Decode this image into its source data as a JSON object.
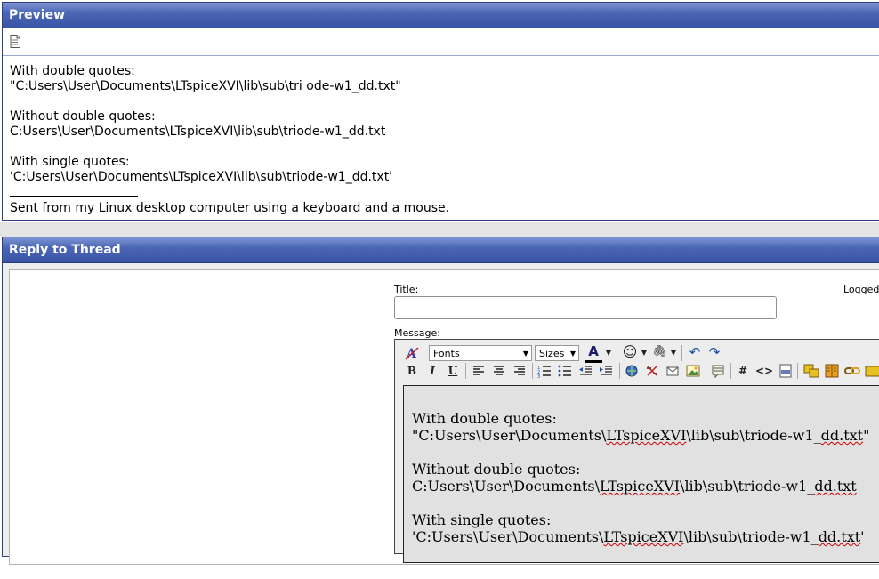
{
  "preview": {
    "header": "Preview",
    "icon": "document-icon",
    "lines": [
      "With double quotes:",
      "\"C:Users\\User\\Documents\\LTspiceXVI\\lib\\sub\\tri ode-w1_dd.txt\"",
      "",
      "Without double quotes:",
      "C:Users\\User\\Documents\\LTspiceXVI\\lib\\sub\\triode-w1_dd.txt",
      "",
      "With single quotes:",
      "'C:Users\\User\\Documents\\LTspiceXVI\\lib\\sub\\triode-w1_dd.txt'"
    ],
    "signature": "Sent from my Linux desktop computer using a keyboard and a mouse."
  },
  "reply": {
    "header": "Reply to Thread",
    "title_label": "Title:",
    "title_value": "",
    "logged_label": "Logged",
    "message_label": "Message:",
    "toolbar": {
      "fonts_label": "Fonts",
      "sizes_label": "Sizes",
      "bold": "B",
      "italic": "I",
      "underline": "U",
      "font_color_glyph": "A",
      "smilies": "☺",
      "attach": "🖇",
      "undo": "↶",
      "redo": "↷",
      "hash": "#",
      "code": "<>"
    },
    "editor": {
      "l1": "With double quotes:",
      "l2_pre": "\"C:Users\\User\\Documents\\",
      "l2_word": "LTspiceXVI",
      "l2_mid": "\\lib\\sub\\triode-w1_",
      "l2_word2": "dd.txt",
      "l2_post": "\"",
      "l3": "Without double quotes:",
      "l4_pre": "C:Users\\User\\Documents\\",
      "l4_word": "LTspiceXVI",
      "l4_mid": "\\lib\\sub\\triode-w1_",
      "l4_word2": "dd.txt",
      "l5": "With single quotes:",
      "l6_pre": "'C:Users\\User\\Documents\\",
      "l6_word": "LTspiceXVI",
      "l6_mid": "\\lib\\sub\\triode-w1_",
      "l6_word2": "dd.txt",
      "l6_post": "'"
    }
  },
  "colors": {
    "header_bg": "#4b67b5",
    "header_text": "#ffffff",
    "panel_border": "#2c3f85",
    "spell_underline": "#d00000"
  }
}
